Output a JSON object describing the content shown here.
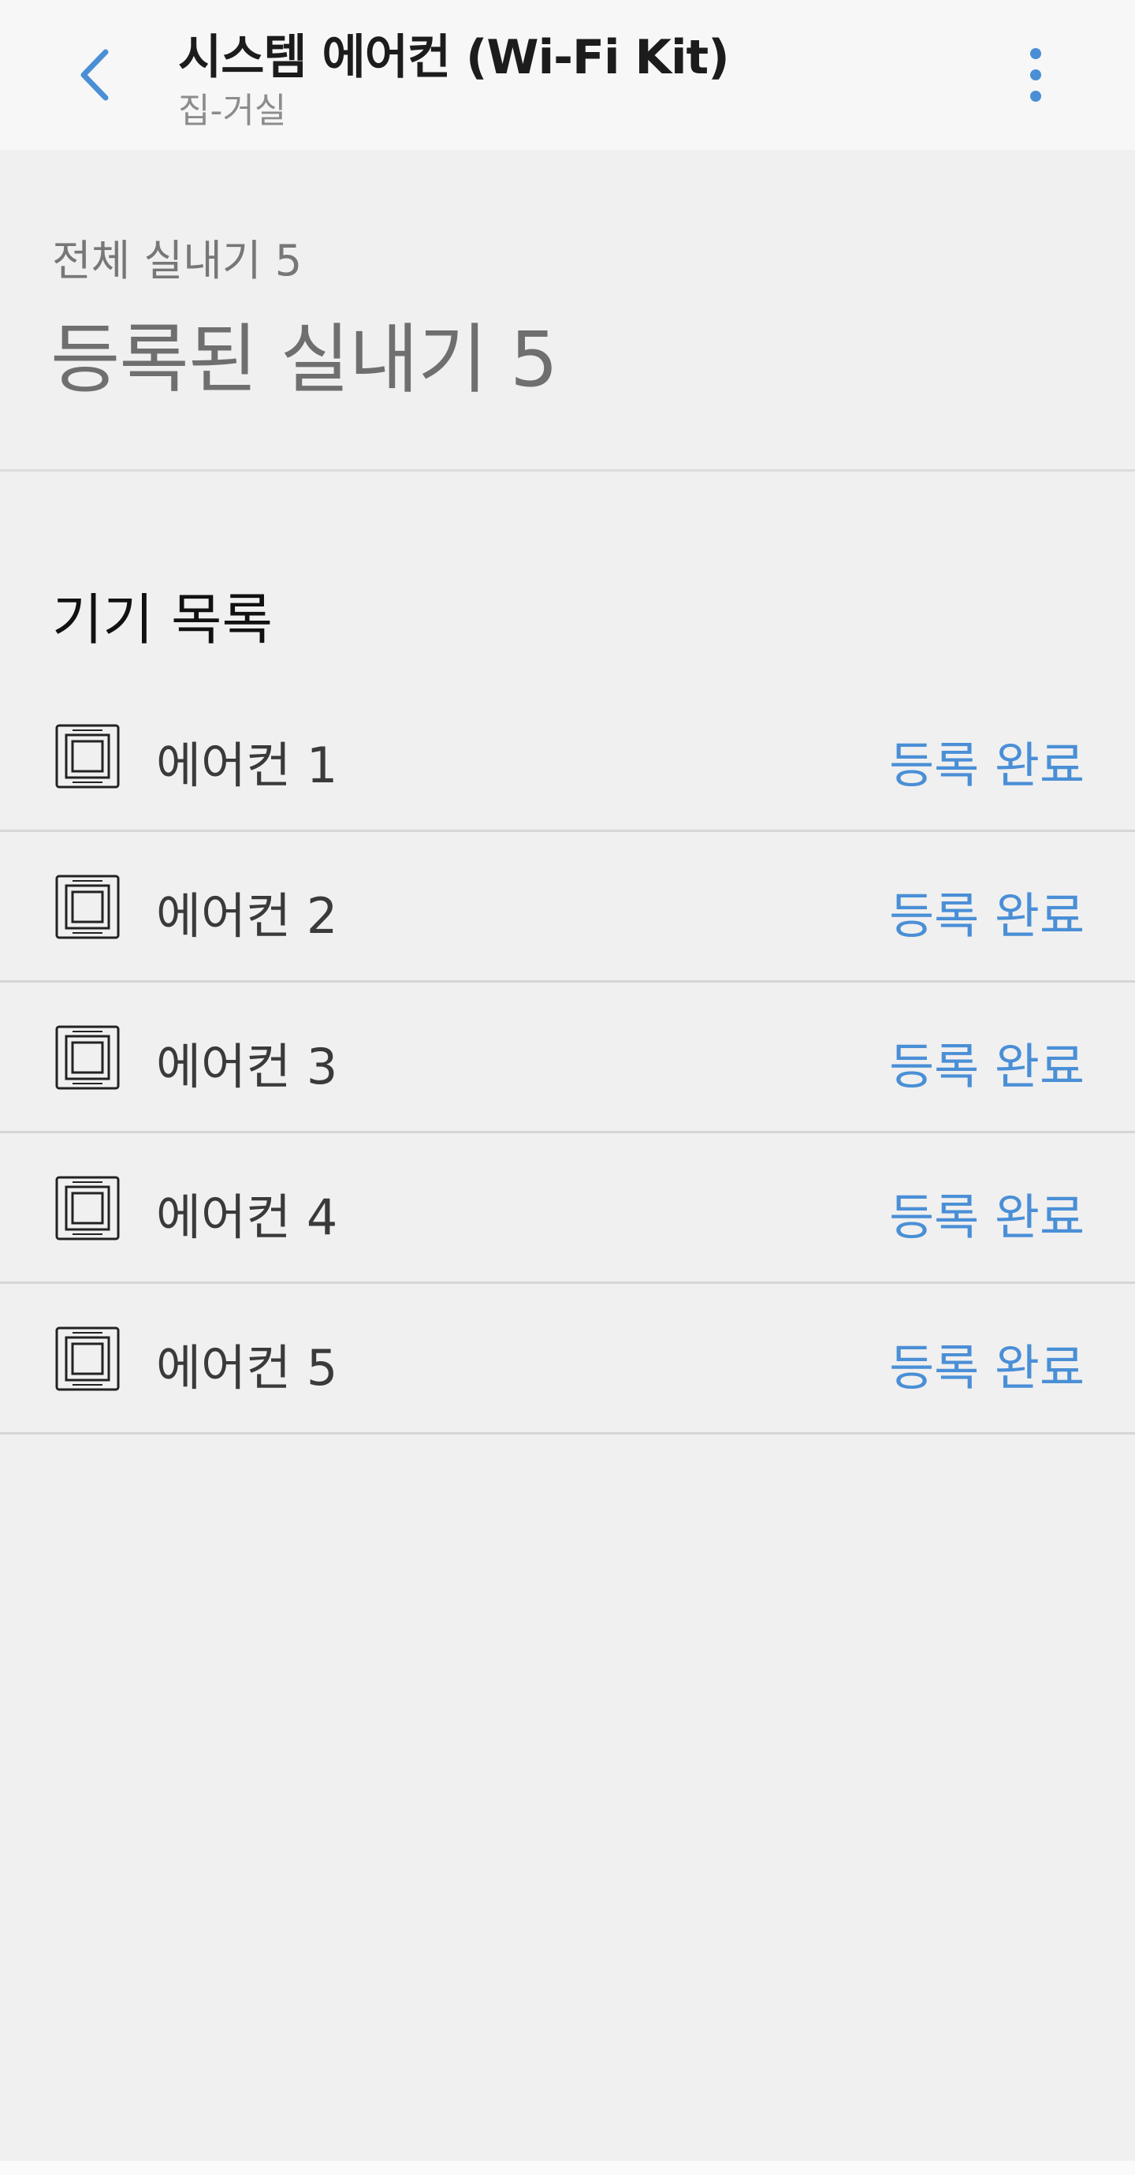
{
  "header": {
    "title": "시스템 에어컨 (Wi-Fi Kit)",
    "subtitle": "집-거실",
    "back_icon": "chevron-left-icon",
    "more_icon": "more-vertical-icon",
    "accent_color": "#4a8fd6"
  },
  "summary": {
    "total_label": "전체 실내기 5",
    "registered_label": "등록된 실내기 5"
  },
  "device_section": {
    "title": "기기 목록",
    "items": [
      {
        "name": "에어컨 1",
        "status": "등록 완료",
        "icon": "indoor-unit-icon"
      },
      {
        "name": "에어컨 2",
        "status": "등록 완료",
        "icon": "indoor-unit-icon"
      },
      {
        "name": "에어컨 3",
        "status": "등록 완료",
        "icon": "indoor-unit-icon"
      },
      {
        "name": "에어컨 4",
        "status": "등록 완료",
        "icon": "indoor-unit-icon"
      },
      {
        "name": "에어컨 5",
        "status": "등록 완료",
        "icon": "indoor-unit-icon"
      }
    ]
  }
}
